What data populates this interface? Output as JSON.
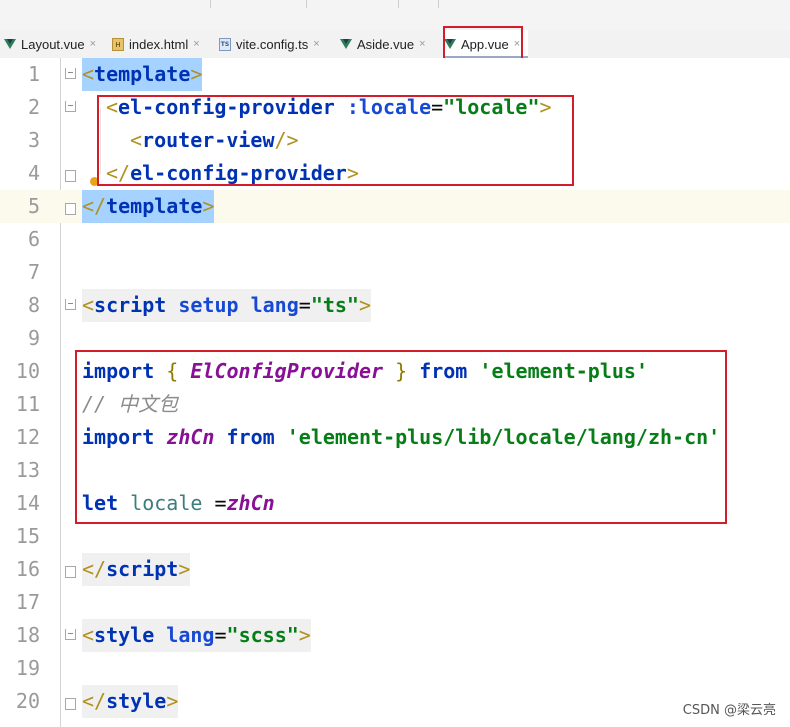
{
  "tabs": [
    {
      "label": "Layout.vue",
      "icon": "vue-file-icon",
      "active": false
    },
    {
      "label": "index.html",
      "icon": "html-file-icon",
      "active": false
    },
    {
      "label": "vite.config.ts",
      "icon": "ts-file-icon",
      "active": false
    },
    {
      "label": "Aside.vue",
      "icon": "vue-file-icon",
      "active": false
    },
    {
      "label": "App.vue",
      "icon": "vue-file-icon",
      "active": true
    }
  ],
  "close_glyph": "×",
  "html_icon_text": "H",
  "ts_icon_text": "TS",
  "line_numbers": [
    "1",
    "2",
    "3",
    "4",
    "5",
    "6",
    "7",
    "8",
    "9",
    "10",
    "11",
    "12",
    "13",
    "14",
    "15",
    "16",
    "17",
    "18",
    "19",
    "20"
  ],
  "code": {
    "l1": {
      "open": "<",
      "tag": "template",
      "close": ">"
    },
    "l2": {
      "open": "<",
      "tag": "el-config-provider",
      "attr": " :locale",
      "eq": "=",
      "val": "\"locale\"",
      "close": ">"
    },
    "l3": {
      "open": "<",
      "tag": "router-view",
      "close": "/>"
    },
    "l4": {
      "open": "</",
      "tag": "el-config-provider",
      "close": ">"
    },
    "l5": {
      "open": "</",
      "tag": "template",
      "close": ">"
    },
    "l8": {
      "open": "<",
      "tag": "script",
      "attr1": " setup",
      "attr2": " lang",
      "eq": "=",
      "val": "\"ts\"",
      "close": ">"
    },
    "l10": {
      "kw": "import",
      "brace_open": "{",
      "name": "ElConfigProvider",
      "brace_close": "}",
      "from": "from",
      "str": "'element-plus'"
    },
    "l11": {
      "comment": "// 中文包"
    },
    "l12": {
      "kw": "import",
      "name": "zhCn",
      "from": "from",
      "str": "'element-plus/lib/locale/lang/zh-cn'"
    },
    "l14": {
      "kw": "let",
      "var": "locale",
      "eq": " =",
      "name": "zhCn"
    },
    "l16": {
      "open": "</",
      "tag": "script",
      "close": ">"
    },
    "l18": {
      "open": "<",
      "tag": "style",
      "attr": " lang",
      "eq": "=",
      "val": "\"scss\"",
      "close": ">"
    },
    "l20": {
      "open": "</",
      "tag": "style",
      "close": ">"
    }
  },
  "watermark": "CSDN @梁云亮",
  "colors": {
    "highlight_box": "#d41d2a",
    "selection": "#a6d2ff",
    "tag": "#0033b3",
    "string": "#067d17"
  }
}
